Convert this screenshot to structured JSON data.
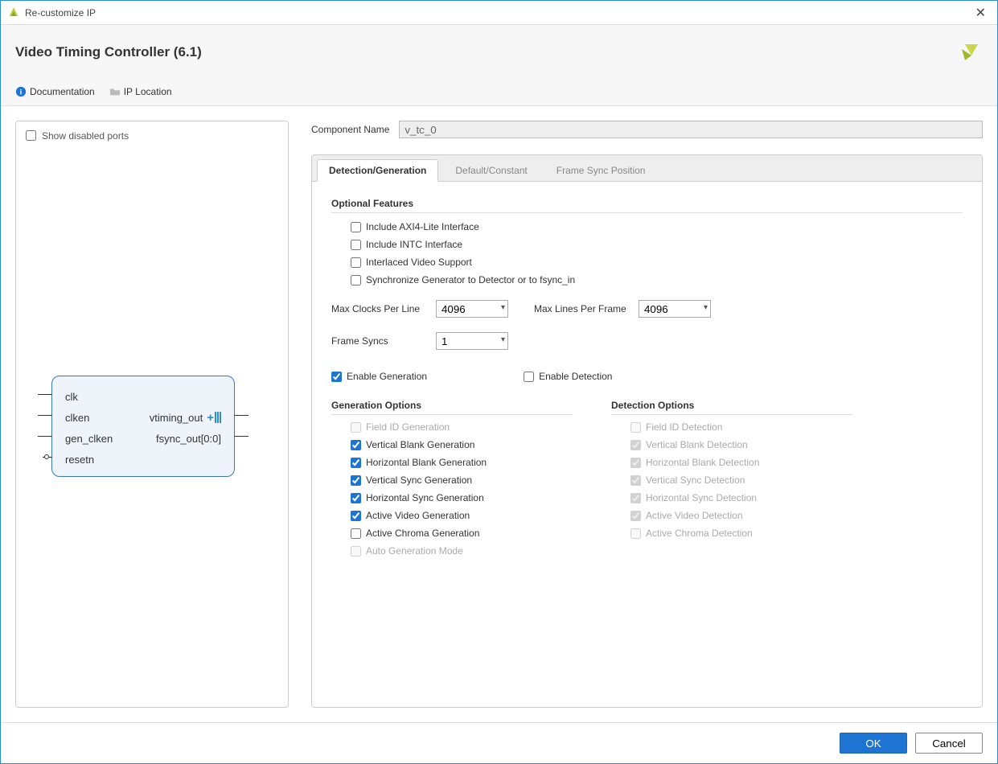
{
  "window": {
    "title": "Re-customize IP"
  },
  "header": {
    "ip_title": "Video Timing Controller (6.1)"
  },
  "links": {
    "documentation": "Documentation",
    "ip_location": "IP Location"
  },
  "preview": {
    "show_disabled_ports_label": "Show disabled ports",
    "ports_left": [
      "clk",
      "clken",
      "gen_clken",
      "resetn"
    ],
    "ports_right": [
      "vtiming_out",
      "fsync_out[0:0]"
    ]
  },
  "component_name": {
    "label": "Component Name",
    "value": "v_tc_0"
  },
  "tabs": {
    "detection_generation": "Detection/Generation",
    "default_constant": "Default/Constant",
    "frame_sync_position": "Frame Sync Position"
  },
  "sections": {
    "optional_features": "Optional Features",
    "generation_options": "Generation Options",
    "detection_options": "Detection Options"
  },
  "optional": {
    "axi4_lite": "Include AXI4-Lite Interface",
    "intc": "Include INTC Interface",
    "interlaced": "Interlaced Video Support",
    "sync_to_detector": "Synchronize Generator to Detector or to fsync_in"
  },
  "dropdowns": {
    "max_clocks_label": "Max Clocks Per Line",
    "max_clocks_value": "4096",
    "max_lines_label": "Max Lines Per Frame",
    "max_lines_value": "4096",
    "frame_syncs_label": "Frame Syncs",
    "frame_syncs_value": "1"
  },
  "enable": {
    "generation": "Enable Generation",
    "detection": "Enable Detection"
  },
  "gen_opts": {
    "field_id": "Field ID Generation",
    "vblank": "Vertical Blank Generation",
    "hblank": "Horizontal Blank Generation",
    "vsync": "Vertical Sync Generation",
    "hsync": "Horizontal Sync Generation",
    "active_video": "Active Video Generation",
    "active_chroma": "Active Chroma Generation",
    "auto_mode": "Auto Generation Mode"
  },
  "det_opts": {
    "field_id": "Field ID Detection",
    "vblank": "Vertical Blank Detection",
    "hblank": "Horizontal Blank Detection",
    "vsync": "Vertical Sync Detection",
    "hsync": "Horizontal Sync Detection",
    "active_video": "Active Video Detection",
    "active_chroma": "Active Chroma Detection"
  },
  "footer": {
    "ok": "OK",
    "cancel": "Cancel"
  }
}
